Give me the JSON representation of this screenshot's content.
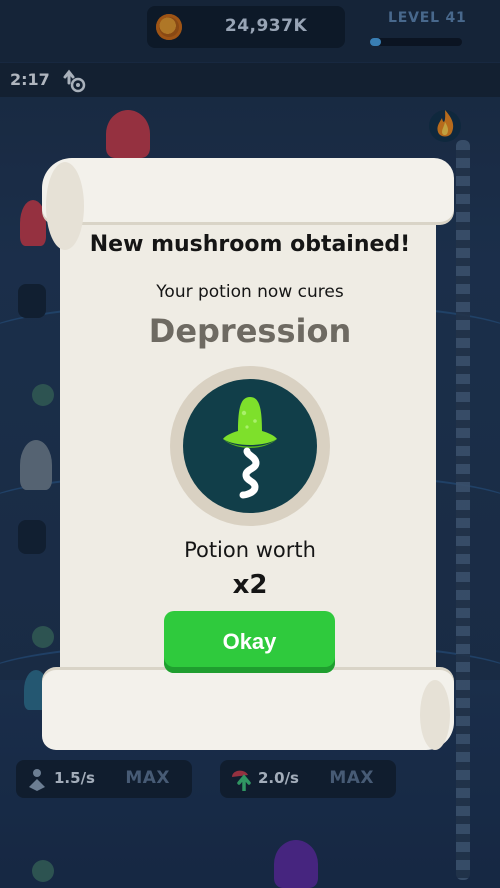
{
  "hud": {
    "coins": "24,937K",
    "level_label": "LEVEL 41",
    "level_progress": 0.12,
    "timer": "2:17"
  },
  "dialog": {
    "title": "New mushroom obtained!",
    "subtitle": "Your potion now cures",
    "disease": "Depression",
    "worth_label": "Potion worth",
    "multiplier": "x2",
    "okay_label": "Okay"
  },
  "upgrades": [
    {
      "rate": "1.5/s",
      "max_label": "MAX"
    },
    {
      "rate": "2.0/s",
      "max_label": "MAX"
    }
  ],
  "colors": {
    "okay_button": "#2fca3d",
    "potion_bg": "#113e49",
    "mushroom_green": "#7ee02b",
    "level_fill": "#4aa3e6"
  }
}
